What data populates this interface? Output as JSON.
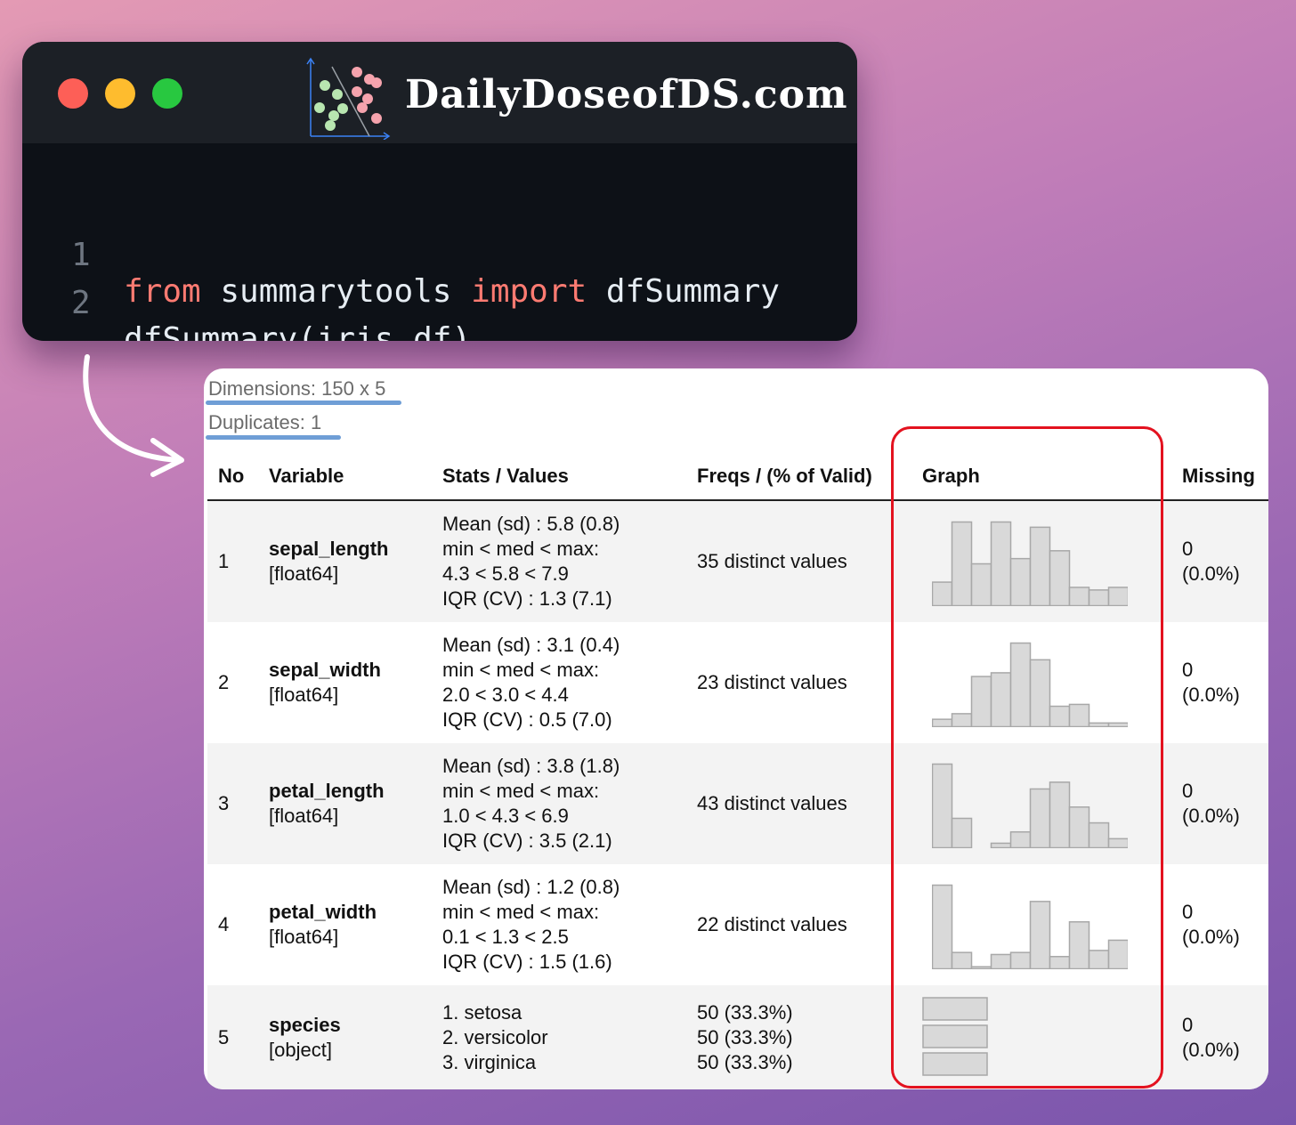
{
  "brand": {
    "name": "DailyDoseofDS.com"
  },
  "code": {
    "lines": [
      {
        "no": "1",
        "kw1": "from",
        "t1": " summarytools ",
        "kw2": "import",
        "t2": " dfSummary"
      },
      {
        "no": "2",
        "text": "dfSummary(iris_df)"
      }
    ]
  },
  "summary": {
    "dimensions": "Dimensions: 150 x 5",
    "duplicates": "Duplicates: 1",
    "headers": {
      "no": "No",
      "variable": "Variable",
      "stats": "Stats / Values",
      "freqs": "Freqs / (% of Valid)",
      "graph": "Graph",
      "missing": "Missing"
    },
    "rows": [
      {
        "no": "1",
        "name": "sepal_length",
        "dtype": "[float64]",
        "stats": [
          "Mean (sd) : 5.8 (0.8)",
          "min < med < max:",
          "4.3 < 5.8 < 7.9",
          "IQR (CV) : 1.3 (7.1)"
        ],
        "freqs": "35 distinct values",
        "missing": "0",
        "missing_pct": "(0.0%)",
        "hist": [
          9,
          32,
          16,
          32,
          18,
          30,
          21,
          7,
          6,
          7
        ]
      },
      {
        "no": "2",
        "name": "sepal_width",
        "dtype": "[float64]",
        "stats": [
          "Mean (sd) : 3.1 (0.4)",
          "min < med < max:",
          "2.0 < 3.0 < 4.4",
          "IQR (CV) : 0.5 (7.0)"
        ],
        "freqs": "23 distinct values",
        "missing": "0",
        "missing_pct": "(0.0%)",
        "hist": [
          4,
          7,
          27,
          29,
          45,
          36,
          11,
          12,
          2,
          2
        ]
      },
      {
        "no": "3",
        "name": "petal_length",
        "dtype": "[float64]",
        "stats": [
          "Mean (sd) : 3.8 (1.8)",
          "min < med < max:",
          "1.0 < 4.3 < 6.9",
          "IQR (CV) : 3.5 (2.1)"
        ],
        "freqs": "43 distinct values",
        "missing": "0",
        "missing_pct": "(0.0%)",
        "hist": [
          37,
          13,
          0,
          2,
          7,
          26,
          29,
          18,
          11,
          4
        ]
      },
      {
        "no": "4",
        "name": "petal_width",
        "dtype": "[float64]",
        "stats": [
          "Mean (sd) : 1.2 (0.8)",
          "min < med < max:",
          "0.1 < 1.3 < 2.5",
          "IQR (CV) : 1.5 (1.6)"
        ],
        "freqs": "22 distinct values",
        "missing": "0",
        "missing_pct": "(0.0%)",
        "hist": [
          41,
          8,
          1,
          7,
          8,
          33,
          6,
          23,
          9,
          14
        ]
      },
      {
        "no": "5",
        "name": "species",
        "dtype": "[object]",
        "stats": [
          "1. setosa",
          "2. versicolor",
          "3. virginica"
        ],
        "freqs_list": [
          "50 (33.3%)",
          "50 (33.3%)",
          "50 (33.3%)"
        ],
        "missing": "0",
        "missing_pct": "(0.0%)",
        "bars": [
          50,
          50,
          50
        ]
      }
    ]
  },
  "colors": {
    "bar_fill": "#d9d9d9",
    "bar_stroke": "#a8a8a8",
    "highlight": "#e3121f",
    "underline": "#6f9ed6"
  }
}
